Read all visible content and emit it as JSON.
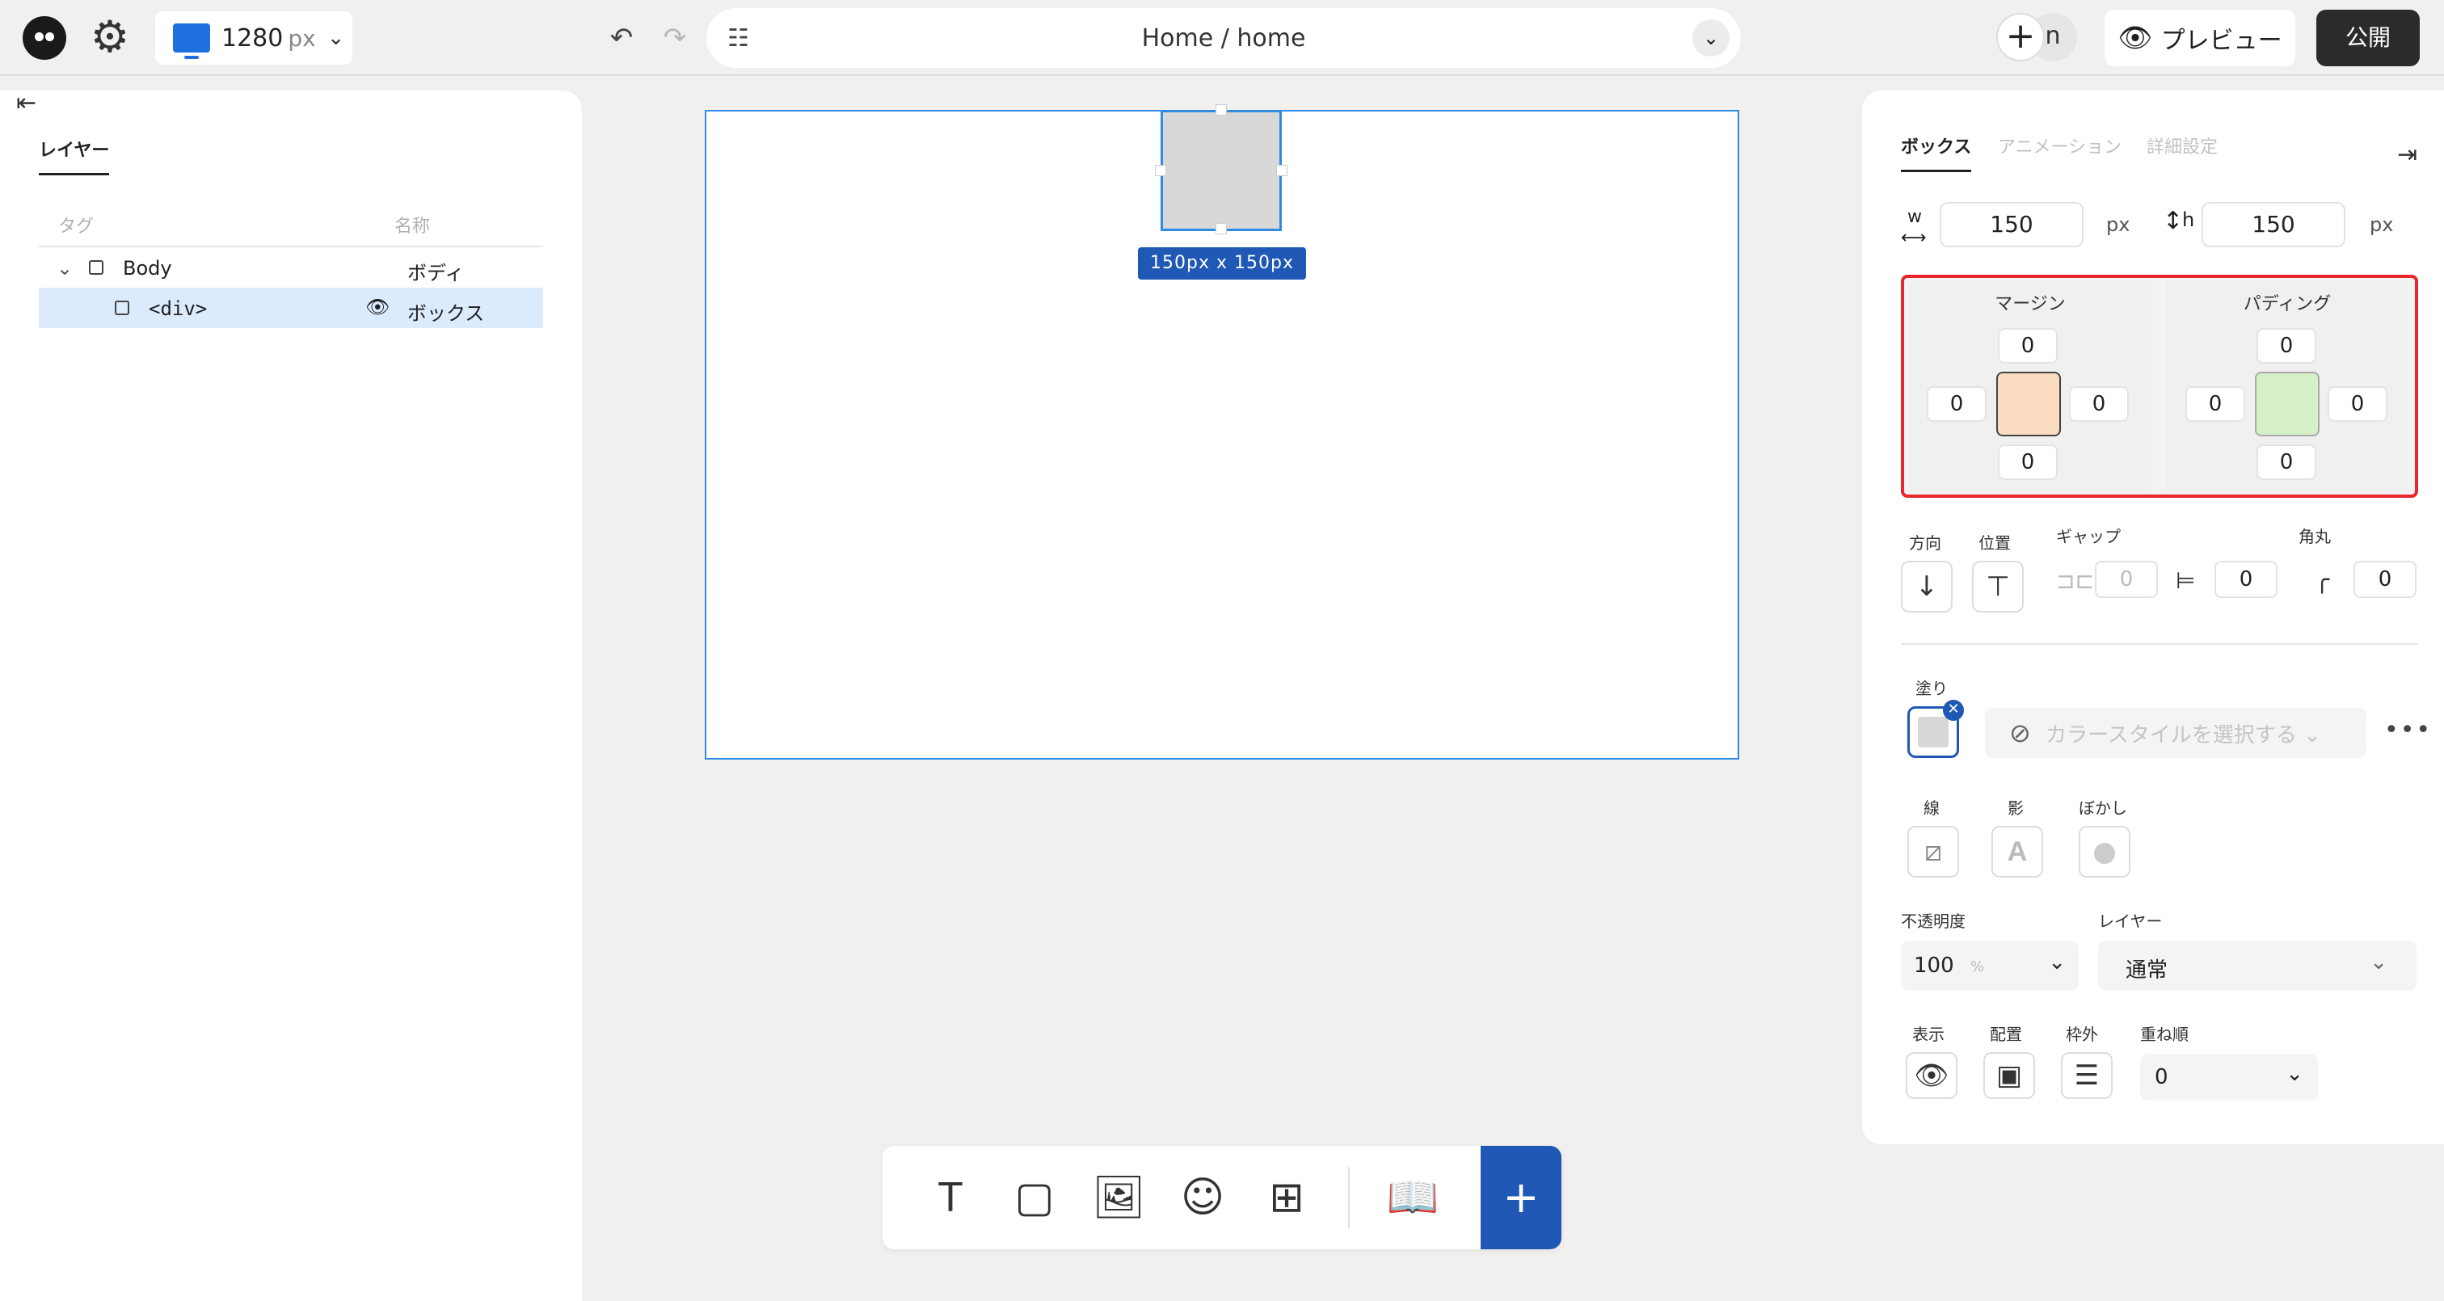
{
  "topbar": {
    "device_width": "1280",
    "device_unit": "px",
    "page_title": "Home  / home",
    "avatar_letter": "n",
    "preview_label": "プレビュー",
    "publish_label": "公開"
  },
  "left_panel": {
    "tab_label": "レイヤー",
    "col_tag": "タグ",
    "col_name": "名称",
    "rows": [
      {
        "tag": "Body",
        "name": "ボディ"
      },
      {
        "tag": "<div>",
        "name": "ボックス"
      }
    ]
  },
  "canvas": {
    "size_label": "150px x 150px"
  },
  "right_panel": {
    "tabs": [
      "ボックス",
      "アニメーション",
      "詳細設定"
    ],
    "width_label": "w",
    "height_label": "h",
    "width_value": "150",
    "height_value": "150",
    "unit": "px",
    "margin": {
      "title": "マージン",
      "top": "0",
      "right": "0",
      "bottom": "0",
      "left": "0"
    },
    "padding": {
      "title": "パディング",
      "top": "0",
      "right": "0",
      "bottom": "0",
      "left": "0"
    },
    "direction_label": "方向",
    "position_label": "位置",
    "gap_label": "ギャップ",
    "gap_value_a": "0",
    "gap_value_b": "0",
    "radius_label": "角丸",
    "radius_value": "0",
    "fill_label": "塗り",
    "color_style_placeholder": "カラースタイルを選択する",
    "stroke_label": "線",
    "shadow_label": "影",
    "blur_label": "ぼかし",
    "opacity_label": "不透明度",
    "opacity_value": "100",
    "opacity_unit": "%",
    "layer_label": "レイヤー",
    "layer_value": "通常",
    "display_label": "表示",
    "placement_label": "配置",
    "overflow_label": "枠外",
    "zindex_label": "重ね順",
    "zindex_value": "0"
  },
  "colors": {
    "accent": "#1f58b5",
    "selection": "#2f8be6",
    "highlight_border": "#e8262c",
    "margin_core": "#f9dcc1",
    "padding_core": "#d6f0c8"
  }
}
